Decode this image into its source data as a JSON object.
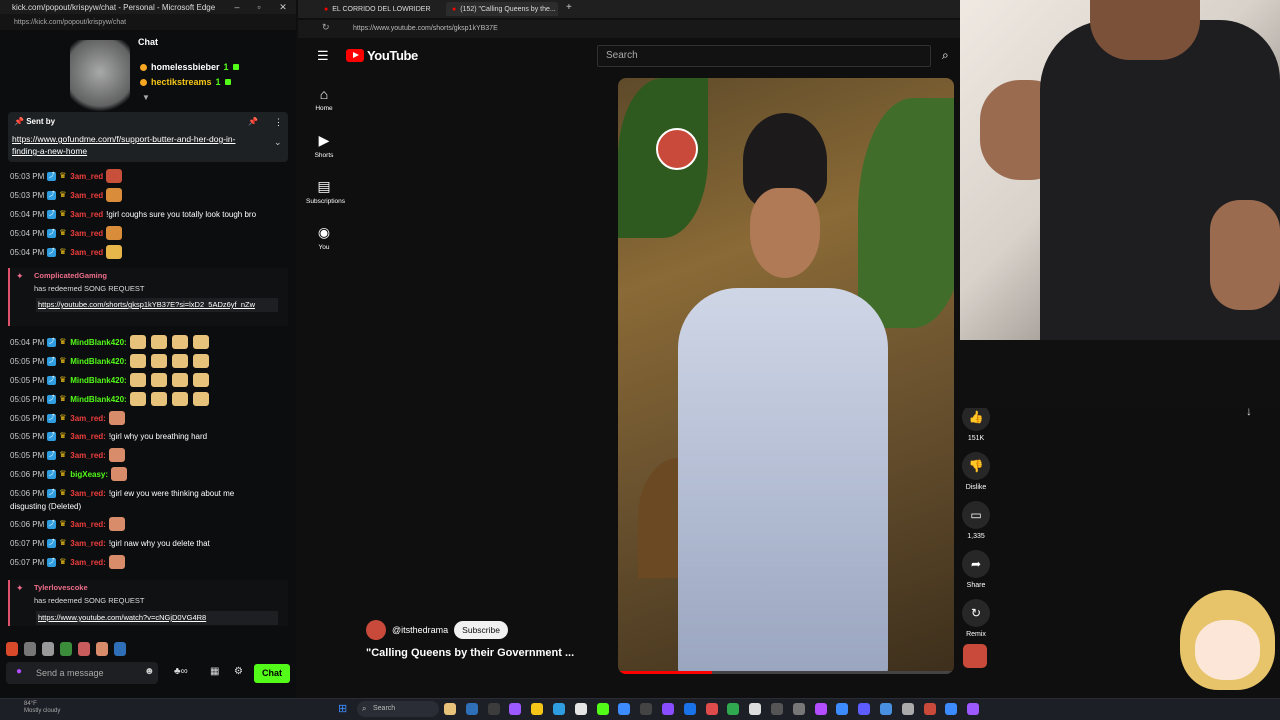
{
  "chat_window": {
    "title": "kick.com/popout/krispyw/chat - Personal - Microsoft Edge",
    "url": "https://kick.com/popout/krispyw/chat",
    "header": "Chat",
    "leaderboard": [
      {
        "name": "homelessbieber",
        "count": "1",
        "color": "#ffffff"
      },
      {
        "name": "hectikstreams",
        "count": "1",
        "color": "#f5c518"
      }
    ],
    "pinned": {
      "label": "Sent by",
      "link": "https://www.gofundme.com/f/support-butter-and-her-dog-in-finding-a-new-home"
    },
    "messages": [
      {
        "ts": "05:03 PM",
        "user": "3am_red",
        "color": "#ef3e3e",
        "text": ""
      },
      {
        "ts": "05:03 PM",
        "user": "3am_red",
        "color": "#ef3e3e",
        "text": ""
      },
      {
        "ts": "05:04 PM",
        "user": "3am_red",
        "color": "#ef3e3e",
        "text": "!girl coughs sure you totally look tough bro"
      },
      {
        "ts": "05:04 PM",
        "user": "3am_red",
        "color": "#ef3e3e",
        "text": ""
      },
      {
        "ts": "05:04 PM",
        "user": "3am_red",
        "color": "#ef3e3e",
        "text": ""
      }
    ],
    "redeem1": {
      "user": "ComplicatedGaming",
      "text": "has redeemed SONG REQUEST",
      "link": "https://youtube.com/shorts/gksp1kYB37E?si=lxD2_5ADz6yf_nZw"
    },
    "messages2": [
      {
        "ts": "05:04 PM",
        "user": "MindBlank420:",
        "color": "#53fc18",
        "text": ""
      },
      {
        "ts": "05:05 PM",
        "user": "MindBlank420:",
        "color": "#53fc18",
        "text": ""
      },
      {
        "ts": "05:05 PM",
        "user": "MindBlank420:",
        "color": "#53fc18",
        "text": ""
      },
      {
        "ts": "05:05 PM",
        "user": "MindBlank420:",
        "color": "#53fc18",
        "text": ""
      },
      {
        "ts": "05:05 PM",
        "user": "3am_red:",
        "color": "#ef3e3e",
        "text": ""
      },
      {
        "ts": "05:05 PM",
        "user": "3am_red:",
        "color": "#ef3e3e",
        "text": "!girl why you breathing hard"
      },
      {
        "ts": "05:05 PM",
        "user": "3am_red:",
        "color": "#ef3e3e",
        "text": ""
      },
      {
        "ts": "05:06 PM",
        "user": "bigXeasy:",
        "color": "#53fc18",
        "text": ""
      },
      {
        "ts": "05:06 PM",
        "user": "3am_red:",
        "color": "#ef3e3e",
        "text": "!girl ew you were thinking about me"
      },
      {
        "ts": "",
        "user": "",
        "color": "#ffffff",
        "text": "disgusting (Deleted)"
      },
      {
        "ts": "05:06 PM",
        "user": "3am_red:",
        "color": "#ef3e3e",
        "text": ""
      },
      {
        "ts": "05:07 PM",
        "user": "3am_red:",
        "color": "#ef3e3e",
        "text": "!girl naw why you delete that"
      },
      {
        "ts": "05:07 PM",
        "user": "3am_red:",
        "color": "#ef3e3e",
        "text": ""
      }
    ],
    "redeem2": {
      "user": "Tylerlovescoke",
      "text": "has redeemed SONG REQUEST",
      "link": "https://www.youtube.com/watch?v=cNGjD0VG4R8"
    },
    "send_placeholder": "Send a message",
    "chat_button": "Chat"
  },
  "youtube": {
    "tabs": [
      {
        "label": "EL CORRIDO DEL LOWRIDER"
      },
      {
        "label": "(152) \"Calling Queens by the..."
      }
    ],
    "url": "https://www.youtube.com/shorts/gksp1kYB37E",
    "logo": "YouTube",
    "search_placeholder": "Search",
    "nav": [
      {
        "label": "Home",
        "icon": "home-icon",
        "glyph": "⌂"
      },
      {
        "label": "Shorts",
        "icon": "shorts-icon",
        "glyph": "▶"
      },
      {
        "label": "Subscriptions",
        "icon": "subscriptions-icon",
        "glyph": "▤"
      },
      {
        "label": "You",
        "icon": "account-icon",
        "glyph": "◉"
      }
    ],
    "channel": "@itsthedrama",
    "subscribe": "Subscribe",
    "title": "\"Calling Queens by their Government ...",
    "actions": [
      {
        "label": "151K",
        "icon": "like-icon",
        "glyph": "👍"
      },
      {
        "label": "Dislike",
        "icon": "dislike-icon",
        "glyph": "👎"
      },
      {
        "label": "1,335",
        "icon": "comment-icon",
        "glyph": "▭"
      },
      {
        "label": "Share",
        "icon": "share-icon",
        "glyph": "➦"
      },
      {
        "label": "Remix",
        "icon": "remix-icon",
        "glyph": "↻"
      }
    ],
    "progress": 0.28
  },
  "taskbar": {
    "weather_temp": "84°F",
    "weather_text": "Mostly cloudy",
    "search_label": "Search"
  }
}
